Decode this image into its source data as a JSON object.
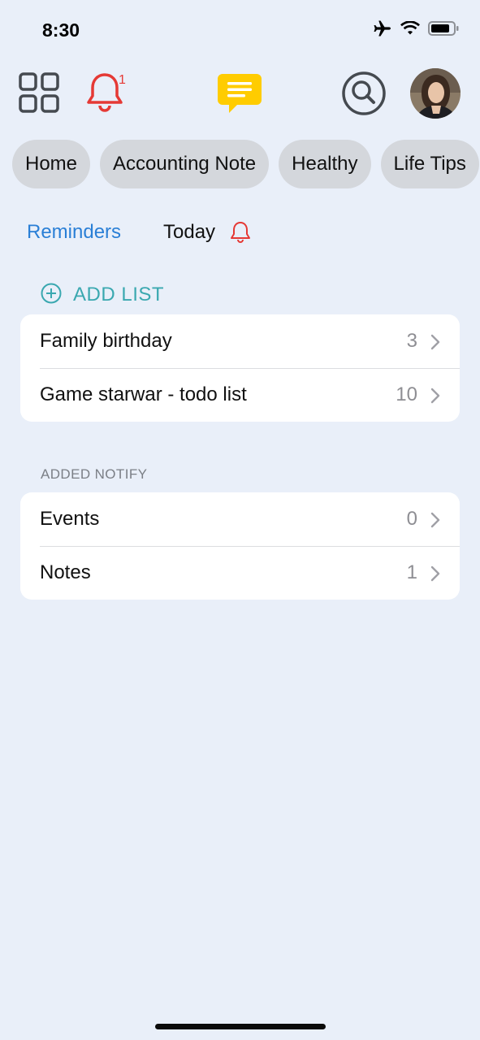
{
  "status_bar": {
    "time": "8:30"
  },
  "toolbar": {
    "notification_badge": "1"
  },
  "categories": [
    "Home",
    "Accounting Note",
    "Healthy",
    "Life Tips"
  ],
  "tabs": {
    "reminders": "Reminders",
    "today": "Today"
  },
  "add_list": {
    "label": "ADD LIST"
  },
  "lists": [
    {
      "label": "Family birthday",
      "count": "3"
    },
    {
      "label": "Game starwar - todo list",
      "count": "10"
    }
  ],
  "notify": {
    "header": "ADDED NOTIFY",
    "items": [
      {
        "label": "Events",
        "count": "0"
      },
      {
        "label": "Notes",
        "count": "1"
      }
    ]
  },
  "colors": {
    "accent_blue": "#2a7fd6",
    "teal": "#3aa8b0",
    "bell_red": "#e53935",
    "chat_yellow": "#ffcc00",
    "background": "#e9eff9"
  },
  "icons": [
    "airplane-icon",
    "wifi-icon",
    "battery-icon",
    "grid-icon",
    "bell-icon",
    "chat-icon",
    "search-icon",
    "plus-circle-icon",
    "chevron-right-icon"
  ]
}
